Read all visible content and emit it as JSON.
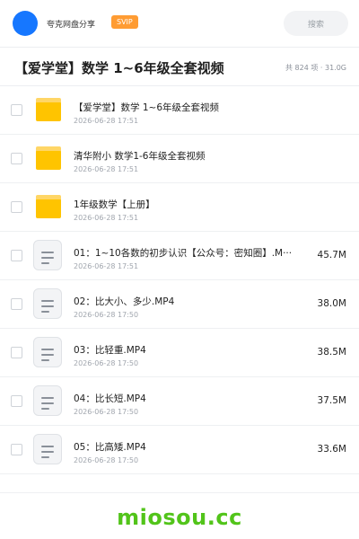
{
  "header": {
    "share_name": "夸克网盘分享",
    "badge": "SVIP",
    "search_placeholder": "搜索"
  },
  "folder": {
    "title": "【爱学堂】数学 1~6年级全套视频",
    "meta": "共 824 项 · 31.0G"
  },
  "items": [
    {
      "type": "folder",
      "name": "【爱学堂】数学 1~6年级全套视频",
      "date": "2026-06-28 17:51",
      "size": ""
    },
    {
      "type": "folder",
      "name": "清华附小 数学1-6年级全套视频",
      "date": "2026-06-28 17:51",
      "size": ""
    },
    {
      "type": "folder",
      "name": "1年级数学【上册】",
      "date": "2026-06-28 17:51",
      "size": ""
    },
    {
      "type": "file",
      "name": "01：1~10各数的初步认识【公众号：密知圈】.M···",
      "date": "2026-06-28 17:51",
      "size": "45.7M"
    },
    {
      "type": "file",
      "name": "02：比大小、多少.MP4",
      "date": "2026-06-28 17:50",
      "size": "38.0M"
    },
    {
      "type": "file",
      "name": "03：比轻重.MP4",
      "date": "2026-06-28 17:50",
      "size": "38.5M"
    },
    {
      "type": "file",
      "name": "04：比长短.MP4",
      "date": "2026-06-28 17:50",
      "size": "37.5M"
    },
    {
      "type": "file",
      "name": "05：比高矮.MP4",
      "date": "2026-06-28 17:50",
      "size": "33.6M"
    }
  ],
  "watermark": "miosou.cc",
  "colors": {
    "accent": "#1677ff",
    "badge": "#ff9c33",
    "folder": "#ffc400",
    "watermark": "#52c41a"
  }
}
